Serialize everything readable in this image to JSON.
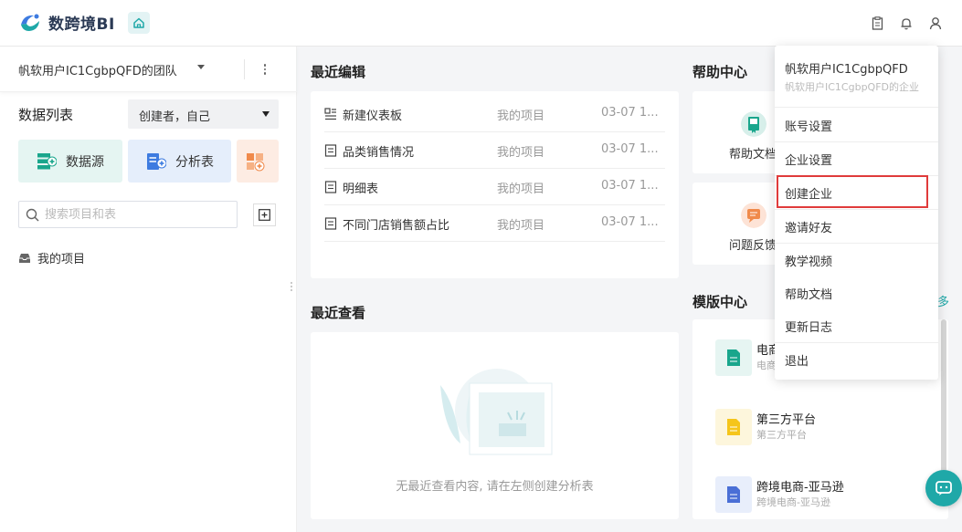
{
  "app": {
    "brand": "数跨境BI"
  },
  "team": {
    "name": "帆软用户IC1CgbpQFD的团队"
  },
  "sidebar": {
    "list_title": "数据列表",
    "creator_filter": "创建者，自己",
    "quick_buttons": [
      {
        "label": "数据源",
        "color": "#19a68c"
      },
      {
        "label": "分析表",
        "color": "#3d7be0"
      },
      {
        "label": "",
        "color": "#f08a4b"
      }
    ],
    "search_placeholder": "搜索项目和表",
    "project": "我的项目"
  },
  "recent_edit": {
    "title": "最近编辑",
    "rows": [
      {
        "icon": "dashboard-icon",
        "name": "新建仪表板",
        "project": "我的项目",
        "date": "03-07 1..."
      },
      {
        "icon": "doc-icon",
        "name": "品类销售情况",
        "project": "我的项目",
        "date": "03-07 1..."
      },
      {
        "icon": "doc-icon",
        "name": "明细表",
        "project": "我的项目",
        "date": "03-07 1..."
      },
      {
        "icon": "doc-icon",
        "name": "不同门店销售额占比",
        "project": "我的项目",
        "date": "03-07 1..."
      }
    ]
  },
  "recent_view": {
    "title": "最近查看",
    "empty_text": "无最近查看内容, 请在左侧创建分析表"
  },
  "help": {
    "title": "帮助中心",
    "cards": [
      {
        "label": "帮助文档",
        "icon": "book-icon",
        "color": "#19a68c"
      },
      {
        "label": "问题反馈",
        "icon": "feedback-icon",
        "color": "#f08a4b"
      }
    ]
  },
  "templates": {
    "title": "模版中心",
    "more": "多",
    "items": [
      {
        "name": "电商",
        "sub": "电商",
        "icon": "template-doc-icon",
        "color": "#19a68c"
      },
      {
        "name": "第三方平台",
        "sub": "第三方平台",
        "icon": "template-doc-icon",
        "color": "#f5c51b"
      },
      {
        "name": "跨境电商-亚马逊",
        "sub": "跨境电商-亚马逊",
        "icon": "template-doc-icon",
        "color": "#4a6fd6"
      }
    ]
  },
  "user_menu": {
    "username": "帆软用户IC1CgbpQFD",
    "team": "帆软用户IC1CgbpQFD的企业",
    "items": [
      "账号设置",
      "企业设置",
      "创建企业",
      "邀请好友",
      "教学视频",
      "帮助文档",
      "更新日志",
      "退出"
    ],
    "highlighted": "创建企业"
  },
  "colors": {
    "accent": "#1fa8a8",
    "highlight_border": "#e03b3b"
  }
}
